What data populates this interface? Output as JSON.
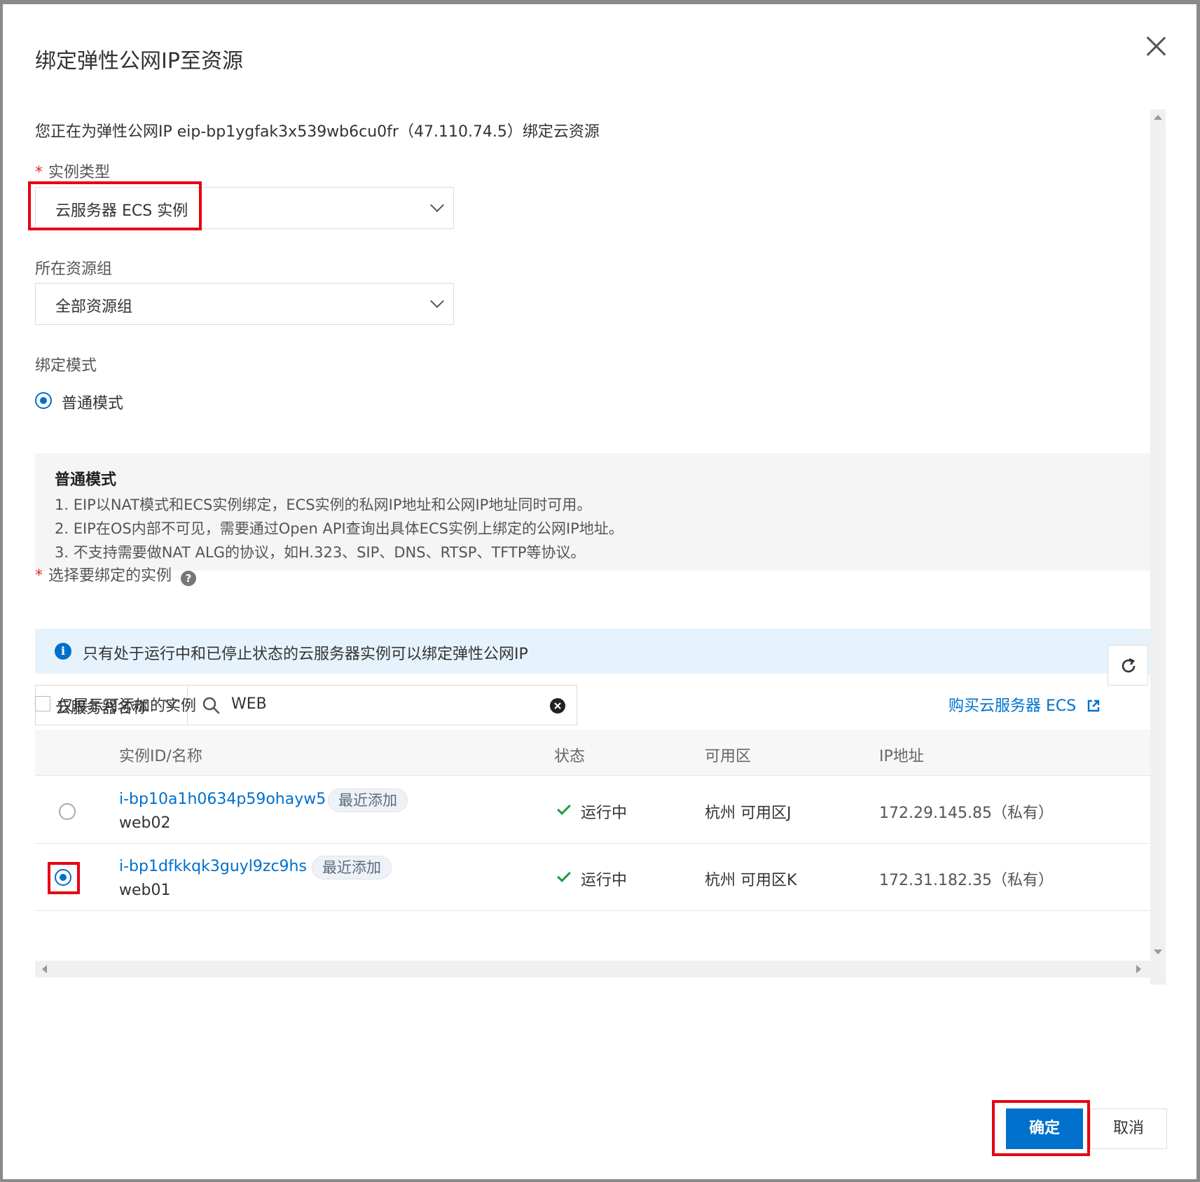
{
  "dialog": {
    "title": "绑定弹性公网IP至资源",
    "description": "您正在为弹性公网IP eip-bp1ygfak3x539wb6cu0fr（47.110.74.5）绑定云资源"
  },
  "form": {
    "instance_type": {
      "required_mark": "*",
      "label": "实例类型",
      "value": "云服务器 ECS 实例"
    },
    "resource_group": {
      "label": "所在资源组",
      "value": "全部资源组"
    },
    "bind_mode": {
      "label": "绑定模式",
      "option": "普通模式",
      "info_title": "普通模式",
      "info_lines": [
        "1. EIP以NAT模式和ECS实例绑定，ECS实例的私网IP地址和公网IP地址同时可用。",
        "2. EIP在OS内部不可见，需要通过Open API查询出具体ECS实例上绑定的公网IP地址。",
        "3. 不支持需要做NAT ALG的协议，如H.323、SIP、DNS、RTSP、TFTP等协议。"
      ]
    },
    "instance_select": {
      "required_mark": "*",
      "label": "选择要绑定的实例",
      "help_icon": "?",
      "notice": "只有处于运行中和已停止状态的云服务器实例可以绑定弹性公网IP",
      "filter_field": "云服务器名称",
      "search_value": "WEB",
      "buy_link": "购买云服务器 ECS",
      "only_addable_label": "仅展示可添加的实例"
    }
  },
  "table": {
    "columns": [
      "实例ID/名称",
      "状态",
      "可用区",
      "IP地址"
    ],
    "rows": [
      {
        "id": "i-bp10a1h0634p59ohayw5",
        "name": "web02",
        "tag": "最近添加",
        "status": "运行中",
        "zone": "杭州 可用区J",
        "ip": "172.29.145.85（私有）",
        "selected": false
      },
      {
        "id": "i-bp1dfkkqk3guyl9zc9hs",
        "name": "web01",
        "tag": "最近添加",
        "status": "运行中",
        "zone": "杭州 可用区K",
        "ip": "172.31.182.35（私有）",
        "selected": true
      }
    ]
  },
  "footer": {
    "confirm": "确定",
    "cancel": "取消"
  },
  "colors": {
    "primary": "#0070cc",
    "highlight": "#e60012",
    "success": "#1e9e3e"
  },
  "icons": [
    "close-icon",
    "chevron-down-icon",
    "help-icon",
    "info-icon",
    "search-icon",
    "clear-icon",
    "external-link-icon",
    "refresh-icon",
    "check-icon"
  ]
}
